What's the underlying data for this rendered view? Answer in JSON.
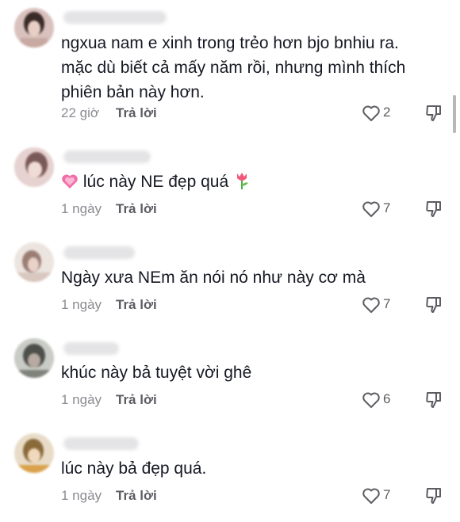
{
  "comments": [
    {
      "text": "ngxua nam e xinh trong trẻo hơn bjo bnhiu ra. mặc dù biết cả mấy năm rồi, nhưng mình thích phiên bản này hơn.",
      "time": "22 giờ",
      "reply_label": "Trả lời",
      "likes": "2"
    },
    {
      "text": "lúc này NE đẹp quá",
      "time": "1 ngày",
      "reply_label": "Trả lời",
      "likes": "7"
    },
    {
      "text": "Ngày xưa NEm ăn nói nó như này cơ mà",
      "time": "1 ngày",
      "reply_label": "Trả lời",
      "likes": "7"
    },
    {
      "text": "khúc này bả tuyệt vời ghê",
      "time": "1 ngày",
      "reply_label": "Trả lời",
      "likes": "6"
    },
    {
      "text": "lúc này bả đẹp quá.",
      "time": "1 ngày",
      "reply_label": "Trả lời",
      "likes": "7"
    }
  ],
  "colors": {
    "text": "#161823",
    "meta": "#8a8b91",
    "action": "#5c5d63"
  },
  "icons": [
    "heart-icon",
    "thumbs-down-icon",
    "heart-emoji",
    "tulip-emoji"
  ]
}
